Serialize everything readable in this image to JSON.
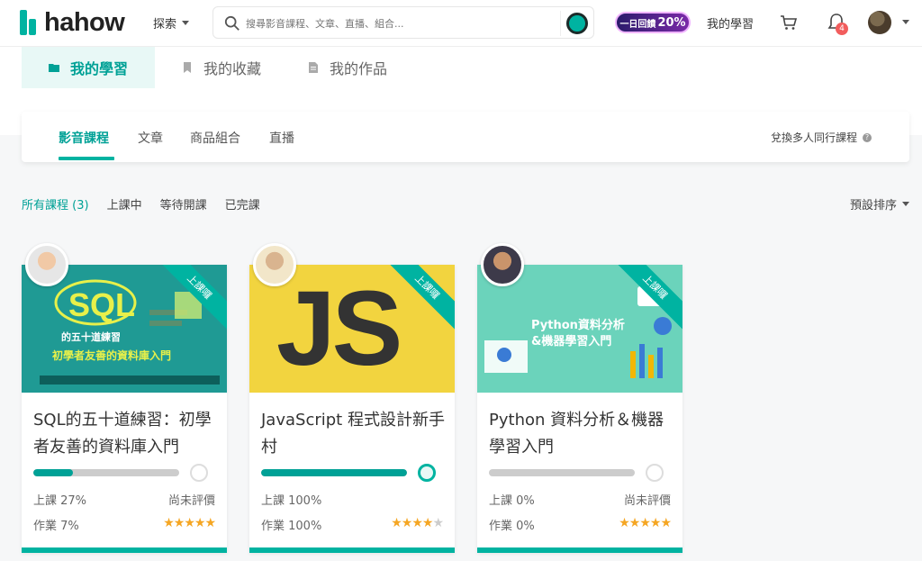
{
  "header": {
    "logo_text": "hahow",
    "explore_label": "探索",
    "search_placeholder": "搜尋影音課程、文章、直播、組合...",
    "promo_label": "一日回饋",
    "promo_value": "20%",
    "my_learning_label": "我的學習",
    "notification_count": "4"
  },
  "page_tabs": [
    {
      "label": "我的學習",
      "icon": "folder-icon",
      "active": true
    },
    {
      "label": "我的收藏",
      "icon": "bookmark-icon",
      "active": false
    },
    {
      "label": "我的作品",
      "icon": "document-icon",
      "active": false
    }
  ],
  "type_tabs": [
    {
      "label": "影音課程",
      "active": true
    },
    {
      "label": "文章",
      "active": false
    },
    {
      "label": "商品組合",
      "active": false
    },
    {
      "label": "直播",
      "active": false
    }
  ],
  "redeem_label": "兌換多人同行課程",
  "filters": [
    {
      "label": "所有課程 (3)",
      "active": true
    },
    {
      "label": "上課中",
      "active": false
    },
    {
      "label": "等待開課",
      "active": false
    },
    {
      "label": "已完課",
      "active": false
    }
  ],
  "sort_label": "預設排序",
  "courses": [
    {
      "title": "SQL的五十道練習：初學者友善的資料庫入門",
      "ribbon": "上課囉",
      "thumb_main": "SQL",
      "thumb_line1": "的五十道練習",
      "thumb_line2": "初學者友善的資料庫入門",
      "progress": 27,
      "lesson_label": "上課 27%",
      "homework_label": "作業 7%",
      "rating_label": "尚未評價",
      "stars": 5
    },
    {
      "title": "JavaScript 程式設計新手村",
      "ribbon": "上課囉",
      "thumb_main": "JS",
      "progress": 100,
      "lesson_label": "上課 100%",
      "homework_label": "作業 100%",
      "rating_label": "",
      "stars": 4
    },
    {
      "title": "Python 資料分析＆機器學習入門",
      "ribbon": "上課囉",
      "thumb_line1": "Python資料分析",
      "thumb_line2": "&機器學習入門",
      "progress": 0,
      "lesson_label": "上課 0%",
      "homework_label": "作業 0%",
      "rating_label": "尚未評價",
      "stars": 5
    }
  ],
  "colors": {
    "accent": "#00b3a1",
    "accent_text": "#00a196",
    "star": "#f5a623",
    "badge": "#f25d5d"
  }
}
